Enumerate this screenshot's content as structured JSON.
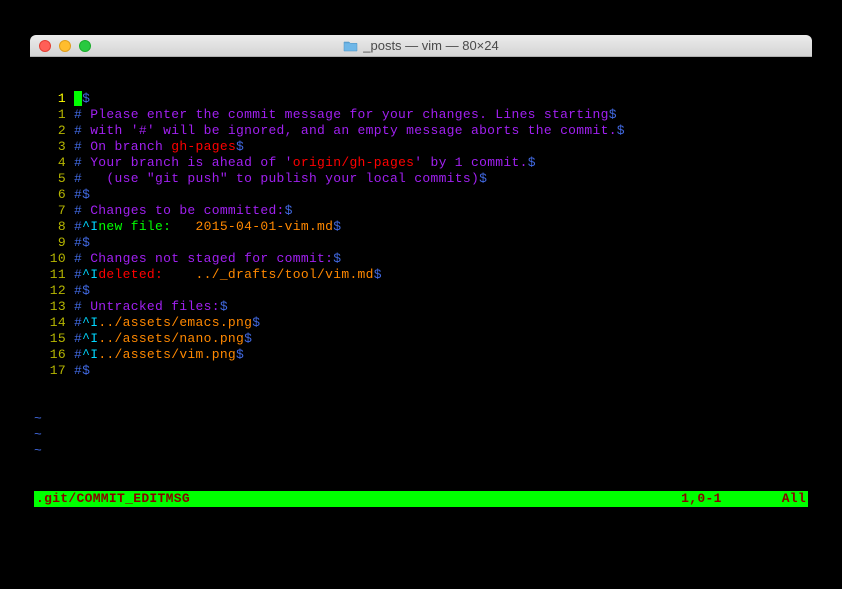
{
  "window": {
    "title": "_posts — vim — 80×24"
  },
  "lines": [
    {
      "n": "1",
      "current": true,
      "segments": [
        {
          "cls": "blockcursor",
          "t": " "
        },
        {
          "cls": "eol",
          "t": "$"
        }
      ]
    },
    {
      "n": "1",
      "segments": [
        {
          "cls": "hash",
          "t": "#"
        },
        {
          "cls": "comment",
          "t": " Please enter the commit message for your changes. Lines starting"
        },
        {
          "cls": "eol",
          "t": "$"
        }
      ]
    },
    {
      "n": "2",
      "segments": [
        {
          "cls": "hash",
          "t": "#"
        },
        {
          "cls": "comment",
          "t": " with '#' will be ignored, and an empty message aborts the commit."
        },
        {
          "cls": "eol",
          "t": "$"
        }
      ]
    },
    {
      "n": "3",
      "segments": [
        {
          "cls": "hash",
          "t": "#"
        },
        {
          "cls": "comment",
          "t": " On branch "
        },
        {
          "cls": "branch",
          "t": "gh-pages"
        },
        {
          "cls": "eol",
          "t": "$"
        }
      ]
    },
    {
      "n": "4",
      "segments": [
        {
          "cls": "hash",
          "t": "#"
        },
        {
          "cls": "comment",
          "t": " Your branch is ahead of '"
        },
        {
          "cls": "branch",
          "t": "origin/gh-pages"
        },
        {
          "cls": "comment",
          "t": "' by 1 commit."
        },
        {
          "cls": "eol",
          "t": "$"
        }
      ]
    },
    {
      "n": "5",
      "segments": [
        {
          "cls": "hash",
          "t": "#"
        },
        {
          "cls": "comment",
          "t": "   (use \"git push\" to publish your local commits)"
        },
        {
          "cls": "eol",
          "t": "$"
        }
      ]
    },
    {
      "n": "6",
      "segments": [
        {
          "cls": "hash",
          "t": "#"
        },
        {
          "cls": "eol",
          "t": "$"
        }
      ]
    },
    {
      "n": "7",
      "segments": [
        {
          "cls": "hash",
          "t": "#"
        },
        {
          "cls": "comment",
          "t": " Changes to be committed:"
        },
        {
          "cls": "eol",
          "t": "$"
        }
      ]
    },
    {
      "n": "8",
      "segments": [
        {
          "cls": "hash",
          "t": "#"
        },
        {
          "cls": "listchar",
          "t": "^I"
        },
        {
          "cls": "newfile",
          "t": "new file:   "
        },
        {
          "cls": "filepath",
          "t": "2015-04-01-vim.md"
        },
        {
          "cls": "eol",
          "t": "$"
        }
      ]
    },
    {
      "n": "9",
      "segments": [
        {
          "cls": "hash",
          "t": "#"
        },
        {
          "cls": "eol",
          "t": "$"
        }
      ]
    },
    {
      "n": "10",
      "segments": [
        {
          "cls": "hash",
          "t": "#"
        },
        {
          "cls": "comment",
          "t": " Changes not staged for commit:"
        },
        {
          "cls": "eol",
          "t": "$"
        }
      ]
    },
    {
      "n": "11",
      "segments": [
        {
          "cls": "hash",
          "t": "#"
        },
        {
          "cls": "listchar",
          "t": "^I"
        },
        {
          "cls": "deleted",
          "t": "deleted:    "
        },
        {
          "cls": "filepath",
          "t": "../_drafts/tool/vim.md"
        },
        {
          "cls": "eol",
          "t": "$"
        }
      ]
    },
    {
      "n": "12",
      "segments": [
        {
          "cls": "hash",
          "t": "#"
        },
        {
          "cls": "eol",
          "t": "$"
        }
      ]
    },
    {
      "n": "13",
      "segments": [
        {
          "cls": "hash",
          "t": "#"
        },
        {
          "cls": "comment",
          "t": " Untracked files:"
        },
        {
          "cls": "eol",
          "t": "$"
        }
      ]
    },
    {
      "n": "14",
      "segments": [
        {
          "cls": "hash",
          "t": "#"
        },
        {
          "cls": "listchar",
          "t": "^I"
        },
        {
          "cls": "filepath",
          "t": "../assets/emacs.png"
        },
        {
          "cls": "eol",
          "t": "$"
        }
      ]
    },
    {
      "n": "15",
      "segments": [
        {
          "cls": "hash",
          "t": "#"
        },
        {
          "cls": "listchar",
          "t": "^I"
        },
        {
          "cls": "filepath",
          "t": "../assets/nano.png"
        },
        {
          "cls": "eol",
          "t": "$"
        }
      ]
    },
    {
      "n": "16",
      "segments": [
        {
          "cls": "hash",
          "t": "#"
        },
        {
          "cls": "listchar",
          "t": "^I"
        },
        {
          "cls": "filepath",
          "t": "../assets/vim.png"
        },
        {
          "cls": "eol",
          "t": "$"
        }
      ]
    },
    {
      "n": "17",
      "segments": [
        {
          "cls": "hash",
          "t": "#"
        },
        {
          "cls": "eol",
          "t": "$"
        }
      ]
    }
  ],
  "tildes": [
    "~",
    "~",
    "~"
  ],
  "status": {
    "file": ".git/COMMIT_EDITMSG",
    "pos": "1,0-1",
    "pct": "All"
  }
}
